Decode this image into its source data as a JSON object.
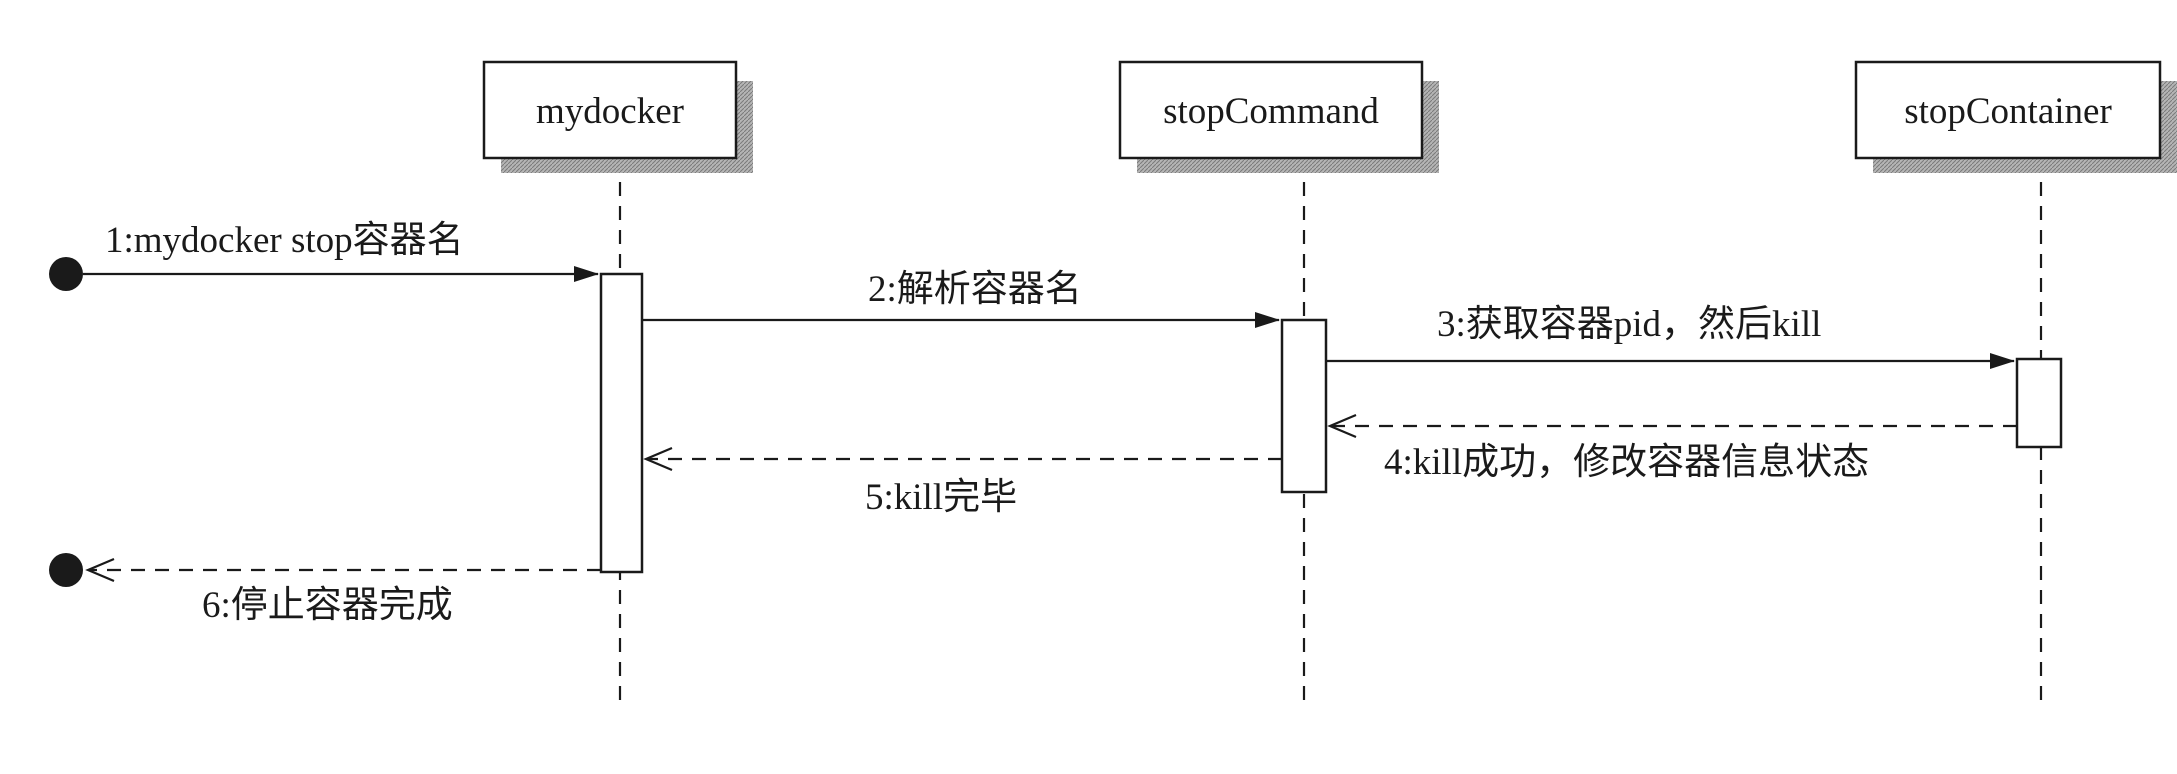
{
  "participants": [
    {
      "id": "mydocker",
      "label": "mydocker"
    },
    {
      "id": "stopCommand",
      "label": "stopCommand"
    },
    {
      "id": "stopContainer",
      "label": "stopContainer"
    }
  ],
  "messages": [
    {
      "id": "m1",
      "label": "1:mydocker stop容器名",
      "style": "solid",
      "from": "start",
      "to": "mydocker"
    },
    {
      "id": "m2",
      "label": "2:解析容器名",
      "style": "solid",
      "from": "mydocker",
      "to": "stopCommand"
    },
    {
      "id": "m3",
      "label": "3:获取容器pid，然后kill",
      "style": "solid",
      "from": "stopCommand",
      "to": "stopContainer"
    },
    {
      "id": "m4",
      "label": "4:kill成功，修改容器信息状态",
      "style": "dashed",
      "from": "stopContainer",
      "to": "stopCommand"
    },
    {
      "id": "m5",
      "label": "5:kill完毕",
      "style": "dashed",
      "from": "stopCommand",
      "to": "mydocker"
    },
    {
      "id": "m6",
      "label": "6:停止容器完成",
      "style": "dashed",
      "from": "mydocker",
      "to": "end"
    }
  ],
  "colors": {
    "line": "#1a1a1a",
    "shadow": "#9a9a9a",
    "box_fill": "#ffffff",
    "endpoint": "#1a1a1a"
  }
}
